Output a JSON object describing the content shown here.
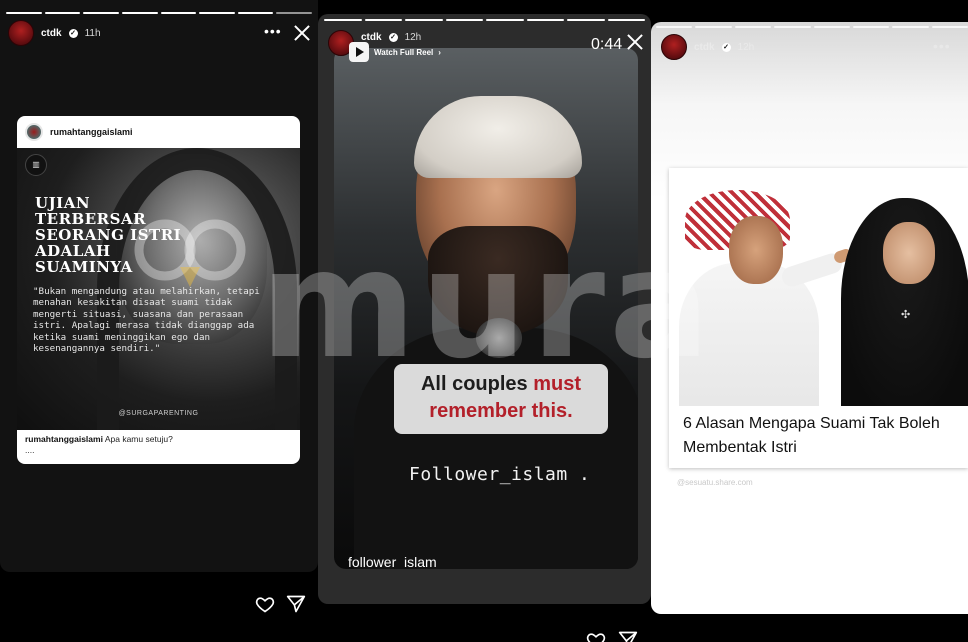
{
  "panels": [
    {
      "username": "ctdk",
      "time": "11h",
      "repost": {
        "account": "rumahtanggaislami",
        "headline": "UJIAN TERBERSAR SEORANG ISTRI ADALAH SUAMINYA",
        "quote": "\"Bukan mengandung atau melahirkan, tetapi menahan kesakitan disaat suami tidak mengerti situasi, suasana dan perasaan istri. Apalagi merasa tidak dianggap ada ketika suami meninggikan ego dan kesenangannya sendiri.\"",
        "credit": "@SURGAPARENTING",
        "caption_user": "rumahtanggaislami",
        "caption_text": "Apa kamu setuju?",
        "caption_more": "...."
      }
    },
    {
      "username": "ctdk",
      "time": "12h",
      "watch_label": "Watch Full Reel",
      "timer": "0:44",
      "overlay_text_1": "All couples ",
      "overlay_text_red_1": "must",
      "overlay_text_red_2": "remember this.",
      "handle_overlay": "Follower_islam .",
      "footer_handle": "follower_islam"
    },
    {
      "username": "ctdk",
      "time": "12h",
      "article_title": "6 Alasan Mengapa Suami Tak Boleh Membentak Istri",
      "faint_credit": "@sesuatu.share.com"
    }
  ],
  "watermark": "mura",
  "colors": {
    "accent_red": "#b3202a",
    "story_progress": "#ffffff"
  },
  "icons": [
    "more-icon",
    "close-icon",
    "heart-icon",
    "send-icon",
    "verified-icon",
    "play-icon"
  ]
}
